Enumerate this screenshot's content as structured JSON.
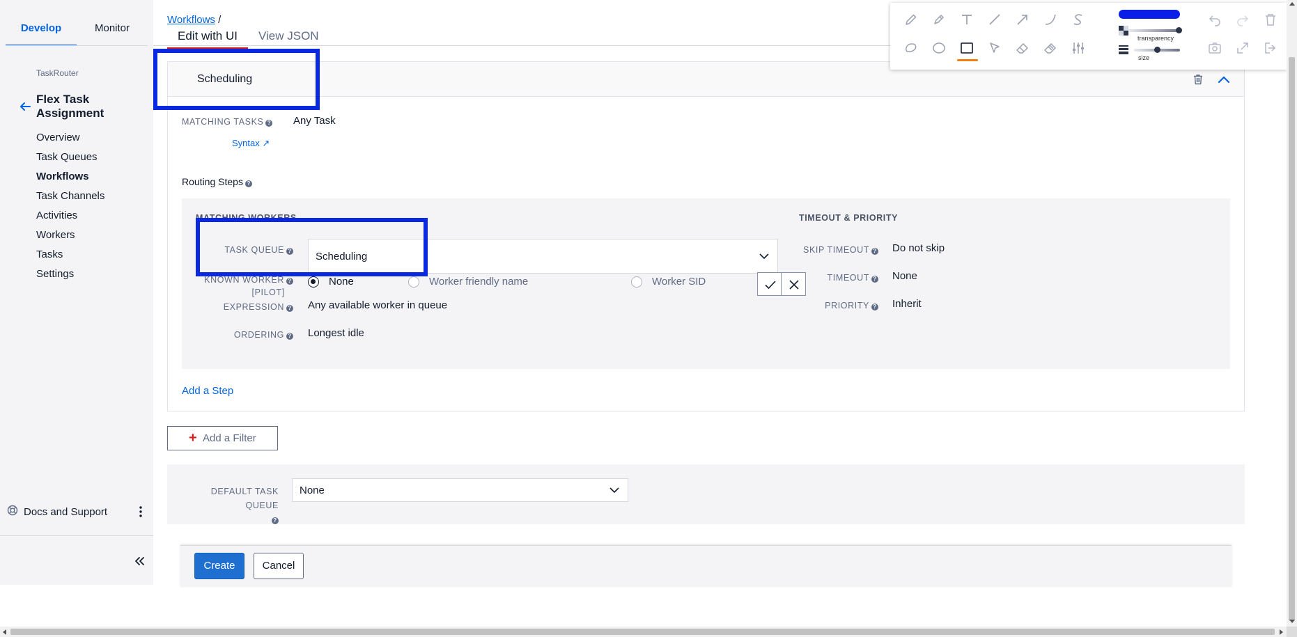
{
  "sidebar": {
    "tabs": [
      {
        "label": "Develop",
        "active": true
      },
      {
        "label": "Monitor",
        "active": false
      }
    ],
    "section": "TaskRouter",
    "title": "Flex Task Assignment",
    "nav": [
      {
        "label": "Overview"
      },
      {
        "label": "Task Queues"
      },
      {
        "label": "Workflows",
        "active": true
      },
      {
        "label": "Task Channels"
      },
      {
        "label": "Activities"
      },
      {
        "label": "Workers"
      },
      {
        "label": "Tasks"
      },
      {
        "label": "Settings"
      }
    ],
    "docs_label": "Docs and Support"
  },
  "breadcrumb": {
    "link": "Workflows",
    "separator": " /"
  },
  "tabs": [
    {
      "label": "Edit with UI",
      "active": true
    },
    {
      "label": "View JSON",
      "active": false
    }
  ],
  "filter": {
    "name": "Scheduling",
    "matching_tasks_label": "MATCHING TASKS",
    "matching_tasks_value": "Any Task",
    "syntax_link": "Syntax ↗",
    "routing_steps_label": "Routing Steps",
    "step": {
      "matching_workers_heading": "MATCHING WORKERS",
      "timeout_priority_heading": "TIMEOUT & PRIORITY",
      "task_queue_label": "TASK QUEUE",
      "task_queue_value": "Scheduling",
      "known_worker_label_1": "KNOWN WORKER",
      "known_worker_label_2": "[PILOT]",
      "known_worker_options": [
        {
          "label": "None",
          "selected": true
        },
        {
          "label": "Worker friendly name",
          "selected": false
        },
        {
          "label": "Worker SID",
          "selected": false
        }
      ],
      "expression_label": "EXPRESSION",
      "expression_value": "Any available worker in queue",
      "ordering_label": "ORDERING",
      "ordering_value": "Longest idle",
      "skip_timeout_label": "SKIP TIMEOUT",
      "skip_timeout_value": "Do not skip",
      "timeout_label": "TIMEOUT",
      "timeout_value": "None",
      "priority_label": "PRIORITY",
      "priority_value": "Inherit"
    },
    "add_step": "Add a Step"
  },
  "add_filter": "Add a Filter",
  "default_task_queue": {
    "label": "DEFAULT TASK QUEUE",
    "value": "None"
  },
  "footer": {
    "create": "Create",
    "cancel": "Cancel"
  },
  "draw_toolbar": {
    "color": "#0a1ee8",
    "transparency_label": "transparency",
    "size_label": "size",
    "transparency_level": 0.95,
    "size_level": 0.5,
    "tools_row1": [
      "pencil-icon",
      "marker-icon",
      "text-icon",
      "line-icon",
      "arrow-icon",
      "curve-icon",
      "freehand-icon"
    ],
    "tools_row2": [
      "lasso-icon",
      "ellipse-icon",
      "rectangle-icon",
      "pointer-icon",
      "eraser-icon",
      "fill-eraser-icon",
      "settings-sliders-icon"
    ],
    "active_tool": "rectangle-icon"
  },
  "colors": {
    "accent": "#0263e0",
    "annotation": "#0a28e0",
    "create_button": "#1f6fd1"
  }
}
